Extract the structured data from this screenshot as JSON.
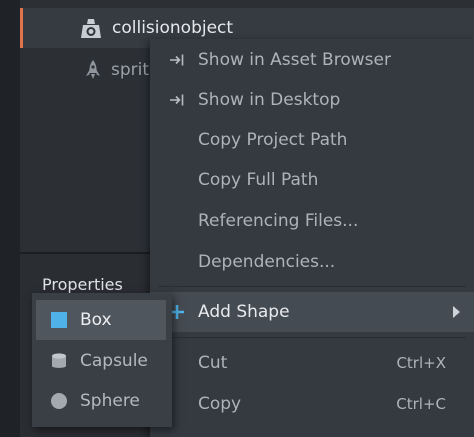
{
  "outline": {
    "items": [
      {
        "label": "collisionobject",
        "icon": "collision-object-icon",
        "selected": true
      },
      {
        "label": "sprite",
        "icon": "sprite-rocket-icon",
        "selected": false
      }
    ]
  },
  "properties": {
    "title": "Properties"
  },
  "context_menu": {
    "items": [
      {
        "label": "Show in Asset Browser",
        "icon": "show-in-icon"
      },
      {
        "label": "Show in Desktop",
        "icon": "show-in-icon"
      },
      {
        "label": "Copy Project Path"
      },
      {
        "label": "Copy Full Path"
      },
      {
        "label": "Referencing Files..."
      },
      {
        "label": "Dependencies..."
      },
      {
        "label": "Add Shape",
        "icon": "plus-icon",
        "has_submenu": true
      },
      {
        "label": "Cut",
        "shortcut": "Ctrl+X"
      },
      {
        "label": "Copy",
        "shortcut": "Ctrl+C"
      }
    ]
  },
  "submenu": {
    "items": [
      {
        "label": "Box",
        "icon": "box-icon"
      },
      {
        "label": "Capsule",
        "icon": "capsule-icon"
      },
      {
        "label": "Sphere",
        "icon": "sphere-icon"
      }
    ]
  },
  "colors": {
    "accent": "#e0734a",
    "box_icon": "#4fb3ea",
    "plus_icon": "#4fb3ea"
  }
}
